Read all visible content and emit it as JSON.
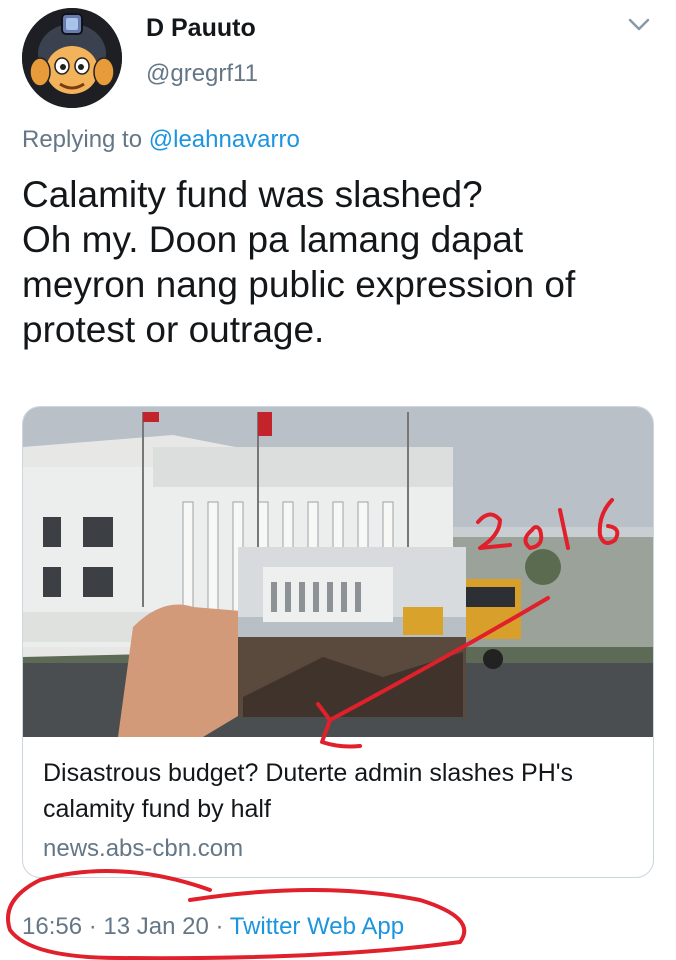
{
  "tweet": {
    "author_name": "D Pauuto",
    "author_handle": "@gregrf11",
    "reply_prefix": "Replying to",
    "reply_to": "@leahnavarro",
    "text_lines": [
      "Calamity fund was slashed?",
      "Oh my. Doon pa lamang dapat",
      "meyron nang public expression of",
      "protest or outrage."
    ],
    "time": "16:56",
    "date": "13 Jan 20",
    "source": "Twitter Web App",
    "separator": "·"
  },
  "card": {
    "title": "Disastrous budget? Duterte admin slashes PH's calamity fund by half",
    "domain": "news.abs-cbn.com"
  },
  "annotation": {
    "handwritten": "2016",
    "color": "#e0202b"
  },
  "icons": {
    "avatar": "cartoon-avatar-icon",
    "menu": "chevron-down-icon"
  },
  "colors": {
    "text": "#14171a",
    "secondary": "#657786",
    "link": "#1b95e0",
    "border": "#ccd6dd"
  }
}
